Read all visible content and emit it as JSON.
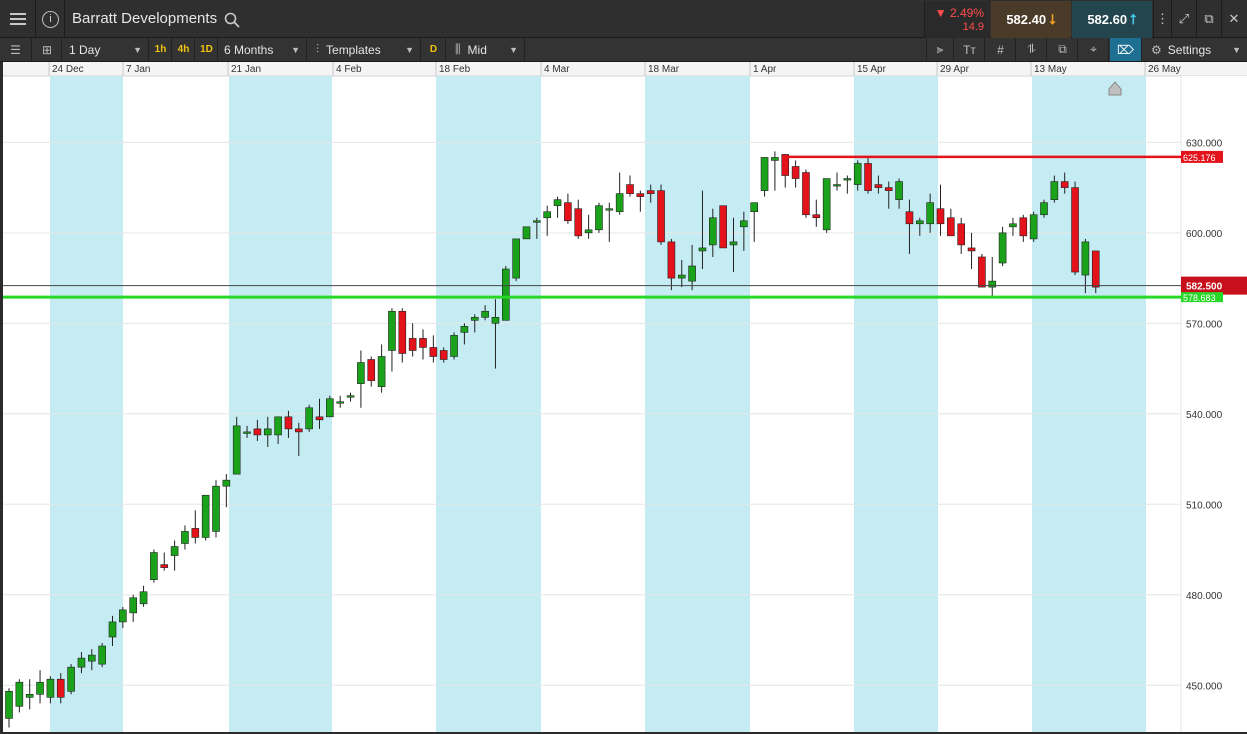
{
  "titlebar": {
    "instrument": "Barratt Developments",
    "info_glyph": "i",
    "change_pct": "▼ 2.49%",
    "change_abs": "14.9",
    "sell_price": "582.40",
    "buy_price": "582.60"
  },
  "toolbar": {
    "interval": "1 Day",
    "tf_1h": "1h",
    "tf_4h": "4h",
    "tf_1d": "1D",
    "range": "6 Months",
    "templates": "Templates",
    "d_label": "D",
    "price_type": "Mid",
    "settings": "Settings"
  },
  "colors": {
    "up": "#1aa31a",
    "down": "#e3121b",
    "band": "#c4ecf2",
    "resistance": "#e3121b",
    "support": "#27d827",
    "current": "#c80f1c"
  },
  "chart_data": {
    "type": "candlestick",
    "y_range": [
      434.5,
      652
    ],
    "y_ticks": [
      "630.000",
      "600.000",
      "570.000",
      "540.000",
      "510.000",
      "480.000",
      "450.000"
    ],
    "x_labels": [
      "24 Dec",
      "7 Jan",
      "21 Jan",
      "4 Feb",
      "18 Feb",
      "4 Mar",
      "18 Mar",
      "1 Apr",
      "15 Apr",
      "29 Apr",
      "13 May",
      "26 May"
    ],
    "resistance_label": "625.176",
    "resistance_value": 625.176,
    "support_label": "578.683",
    "support_value": 578.683,
    "current_label": "582.500",
    "current_value": 582.5,
    "candles": [
      {
        "o": 439,
        "h": 449,
        "l": 436,
        "c": 448
      },
      {
        "o": 443,
        "h": 452,
        "l": 441,
        "c": 451
      },
      {
        "o": 446,
        "h": 452,
        "l": 442,
        "c": 447
      },
      {
        "o": 447,
        "h": 455,
        "l": 444,
        "c": 451
      },
      {
        "o": 446,
        "h": 453,
        "l": 444,
        "c": 452
      },
      {
        "o": 452,
        "h": 454,
        "l": 444,
        "c": 446
      },
      {
        "o": 448,
        "h": 457,
        "l": 447,
        "c": 456
      },
      {
        "o": 456,
        "h": 461,
        "l": 454,
        "c": 459
      },
      {
        "o": 458,
        "h": 462,
        "l": 455,
        "c": 460
      },
      {
        "o": 457,
        "h": 464,
        "l": 456,
        "c": 463
      },
      {
        "o": 466,
        "h": 473,
        "l": 463,
        "c": 471
      },
      {
        "o": 471,
        "h": 476,
        "l": 469,
        "c": 475
      },
      {
        "o": 474,
        "h": 480,
        "l": 471,
        "c": 479
      },
      {
        "o": 477,
        "h": 483,
        "l": 476,
        "c": 481
      },
      {
        "o": 485,
        "h": 495,
        "l": 484,
        "c": 494
      },
      {
        "o": 490,
        "h": 494,
        "l": 488,
        "c": 489
      },
      {
        "o": 493,
        "h": 498,
        "l": 488,
        "c": 496
      },
      {
        "o": 497,
        "h": 503,
        "l": 495,
        "c": 501
      },
      {
        "o": 502,
        "h": 508,
        "l": 497,
        "c": 499
      },
      {
        "o": 499,
        "h": 511,
        "l": 498,
        "c": 513
      },
      {
        "o": 501,
        "h": 518,
        "l": 499,
        "c": 516
      },
      {
        "o": 516,
        "h": 520,
        "l": 509,
        "c": 518
      },
      {
        "o": 520,
        "h": 539,
        "l": 520,
        "c": 536
      },
      {
        "o": 534,
        "h": 536,
        "l": 532,
        "c": 534
      },
      {
        "o": 535,
        "h": 538,
        "l": 531,
        "c": 533
      },
      {
        "o": 533,
        "h": 539,
        "l": 529,
        "c": 535
      },
      {
        "o": 533,
        "h": 538,
        "l": 530,
        "c": 539
      },
      {
        "o": 539,
        "h": 541,
        "l": 532,
        "c": 535
      },
      {
        "o": 535,
        "h": 537,
        "l": 526,
        "c": 534
      },
      {
        "o": 535,
        "h": 543,
        "l": 534,
        "c": 542
      },
      {
        "o": 539,
        "h": 545,
        "l": 535,
        "c": 538
      },
      {
        "o": 539,
        "h": 546,
        "l": 539,
        "c": 545
      },
      {
        "o": 544,
        "h": 546,
        "l": 542,
        "c": 544
      },
      {
        "o": 546,
        "h": 547,
        "l": 544,
        "c": 546
      },
      {
        "o": 550,
        "h": 561,
        "l": 542,
        "c": 557
      },
      {
        "o": 558,
        "h": 559,
        "l": 549,
        "c": 551
      },
      {
        "o": 549,
        "h": 563,
        "l": 547,
        "c": 559
      },
      {
        "o": 561,
        "h": 575,
        "l": 554,
        "c": 574
      },
      {
        "o": 574,
        "h": 575,
        "l": 557,
        "c": 560
      },
      {
        "o": 565,
        "h": 570,
        "l": 559,
        "c": 561
      },
      {
        "o": 565,
        "h": 568,
        "l": 558,
        "c": 562
      },
      {
        "o": 562,
        "h": 566,
        "l": 557,
        "c": 559
      },
      {
        "o": 561,
        "h": 562,
        "l": 557,
        "c": 558
      },
      {
        "o": 559,
        "h": 567,
        "l": 558,
        "c": 566
      },
      {
        "o": 567,
        "h": 570,
        "l": 563,
        "c": 569
      },
      {
        "o": 571,
        "h": 573,
        "l": 567,
        "c": 572
      },
      {
        "o": 572,
        "h": 576,
        "l": 571,
        "c": 574
      },
      {
        "o": 570,
        "h": 578,
        "l": 555,
        "c": 572
      },
      {
        "o": 571,
        "h": 589,
        "l": 571,
        "c": 588
      },
      {
        "o": 585,
        "h": 598,
        "l": 584,
        "c": 598
      },
      {
        "o": 598,
        "h": 601,
        "l": 598,
        "c": 602
      },
      {
        "o": 604,
        "h": 605,
        "l": 598,
        "c": 604
      },
      {
        "o": 605,
        "h": 609,
        "l": 599,
        "c": 607
      },
      {
        "o": 609,
        "h": 612,
        "l": 605,
        "c": 611
      },
      {
        "o": 610,
        "h": 613,
        "l": 603,
        "c": 604
      },
      {
        "o": 608,
        "h": 611,
        "l": 598,
        "c": 599
      },
      {
        "o": 600,
        "h": 606,
        "l": 598,
        "c": 601
      },
      {
        "o": 601,
        "h": 610,
        "l": 600,
        "c": 609
      },
      {
        "o": 608,
        "h": 610,
        "l": 597,
        "c": 608
      },
      {
        "o": 607,
        "h": 620,
        "l": 606,
        "c": 613
      },
      {
        "o": 616,
        "h": 619,
        "l": 612,
        "c": 613
      },
      {
        "o": 613,
        "h": 614,
        "l": 607,
        "c": 612
      },
      {
        "o": 614,
        "h": 616,
        "l": 610,
        "c": 613
      },
      {
        "o": 614,
        "h": 616,
        "l": 596,
        "c": 597
      },
      {
        "o": 597,
        "h": 598,
        "l": 581,
        "c": 585
      },
      {
        "o": 585,
        "h": 591,
        "l": 582,
        "c": 586
      },
      {
        "o": 584,
        "h": 596,
        "l": 581,
        "c": 589
      },
      {
        "o": 594,
        "h": 614,
        "l": 588,
        "c": 595
      },
      {
        "o": 596,
        "h": 608,
        "l": 592,
        "c": 605
      },
      {
        "o": 609,
        "h": 608,
        "l": 598,
        "c": 595
      },
      {
        "o": 596,
        "h": 605,
        "l": 587,
        "c": 597
      },
      {
        "o": 602,
        "h": 607,
        "l": 594,
        "c": 604
      },
      {
        "o": 607,
        "h": 609,
        "l": 597,
        "c": 610
      },
      {
        "o": 614,
        "h": 621,
        "l": 612,
        "c": 625
      },
      {
        "o": 624,
        "h": 627,
        "l": 614,
        "c": 625
      },
      {
        "o": 626,
        "h": 626,
        "l": 615,
        "c": 619
      },
      {
        "o": 622,
        "h": 624,
        "l": 615,
        "c": 618
      },
      {
        "o": 620,
        "h": 621,
        "l": 605,
        "c": 606
      },
      {
        "o": 606,
        "h": 611,
        "l": 602,
        "c": 605
      },
      {
        "o": 601,
        "h": 617,
        "l": 600,
        "c": 618
      },
      {
        "o": 616,
        "h": 620,
        "l": 614,
        "c": 616
      },
      {
        "o": 618,
        "h": 619,
        "l": 613,
        "c": 618
      },
      {
        "o": 616,
        "h": 624,
        "l": 614,
        "c": 623
      },
      {
        "o": 623,
        "h": 625,
        "l": 613,
        "c": 614
      },
      {
        "o": 616,
        "h": 619,
        "l": 613,
        "c": 615
      },
      {
        "o": 615,
        "h": 617,
        "l": 608,
        "c": 614
      },
      {
        "o": 611,
        "h": 618,
        "l": 608,
        "c": 617
      },
      {
        "o": 607,
        "h": 611,
        "l": 593,
        "c": 603
      },
      {
        "o": 603,
        "h": 605,
        "l": 599,
        "c": 604
      },
      {
        "o": 603,
        "h": 613,
        "l": 600,
        "c": 610
      },
      {
        "o": 608,
        "h": 616,
        "l": 599,
        "c": 603
      },
      {
        "o": 605,
        "h": 608,
        "l": 599,
        "c": 599
      },
      {
        "o": 603,
        "h": 605,
        "l": 593,
        "c": 596
      },
      {
        "o": 595,
        "h": 600,
        "l": 588,
        "c": 594
      },
      {
        "o": 592,
        "h": 593,
        "l": 582,
        "c": 582
      },
      {
        "o": 582,
        "h": 592,
        "l": 579,
        "c": 584
      },
      {
        "o": 590,
        "h": 602,
        "l": 589,
        "c": 600
      },
      {
        "o": 602,
        "h": 605,
        "l": 599,
        "c": 603
      },
      {
        "o": 605,
        "h": 606,
        "l": 597,
        "c": 599
      },
      {
        "o": 598,
        "h": 607,
        "l": 597,
        "c": 606
      },
      {
        "o": 606,
        "h": 611,
        "l": 605,
        "c": 610
      },
      {
        "o": 611,
        "h": 619,
        "l": 610,
        "c": 617
      },
      {
        "o": 617,
        "h": 620,
        "l": 613,
        "c": 615
      },
      {
        "o": 615,
        "h": 617,
        "l": 586,
        "c": 587
      },
      {
        "o": 586,
        "h": 598,
        "l": 580,
        "c": 597
      },
      {
        "o": 594,
        "h": 594,
        "l": 580,
        "c": 582
      }
    ]
  }
}
